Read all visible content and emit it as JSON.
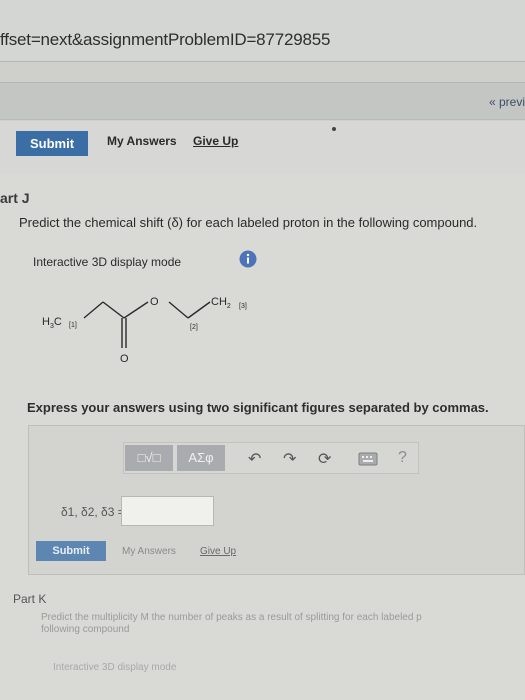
{
  "browser": {
    "url_fragment": "ffset=next&assignmentProblemID=87729855"
  },
  "nav": {
    "previous_label": "« previ"
  },
  "toolbar": {
    "submit_label": "Submit",
    "my_answers_label": "My Answers",
    "give_up_label": "Give Up"
  },
  "part_j": {
    "title": "art J",
    "question": "Predict the chemical shift (δ) for each labeled proton in the following compound.",
    "mode_label": "Interactive 3D display mode",
    "molecule": {
      "h3c_label": "H",
      "h3c_sub": "3",
      "h3c_c": "C",
      "label1": "[1]",
      "label2": "[2]",
      "label3": "[3]",
      "o_ester": "O",
      "o_carbonyl": "O",
      "ch2_label": "CH",
      "ch2_sub": "2"
    },
    "instruction": "Express your answers using two significant figures separated by commas.",
    "editor": {
      "template_button": "□√□",
      "greek_button": "AΣφ",
      "undo_icon": "undo-icon",
      "redo_icon": "redo-icon",
      "reset_icon": "reset-icon",
      "keyboard_icon": "keyboard-icon",
      "help_label": "?"
    },
    "answer_label": "δ1, δ2, δ3 =",
    "answer_value": "",
    "submit_label": "Submit",
    "my_answers_label": "My Answers",
    "give_up_label": "Give Up"
  },
  "part_k": {
    "title": "Part K",
    "question_line1": "Predict the multiplicity M the number of peaks as a result of splitting for each labeled p",
    "question_line2": "following compound",
    "mode_label": "Interactive 3D display mode"
  },
  "colors": {
    "accent_button": "#3a6ea5",
    "info_icon": "#4d73b8",
    "background": "#d9dad6"
  }
}
